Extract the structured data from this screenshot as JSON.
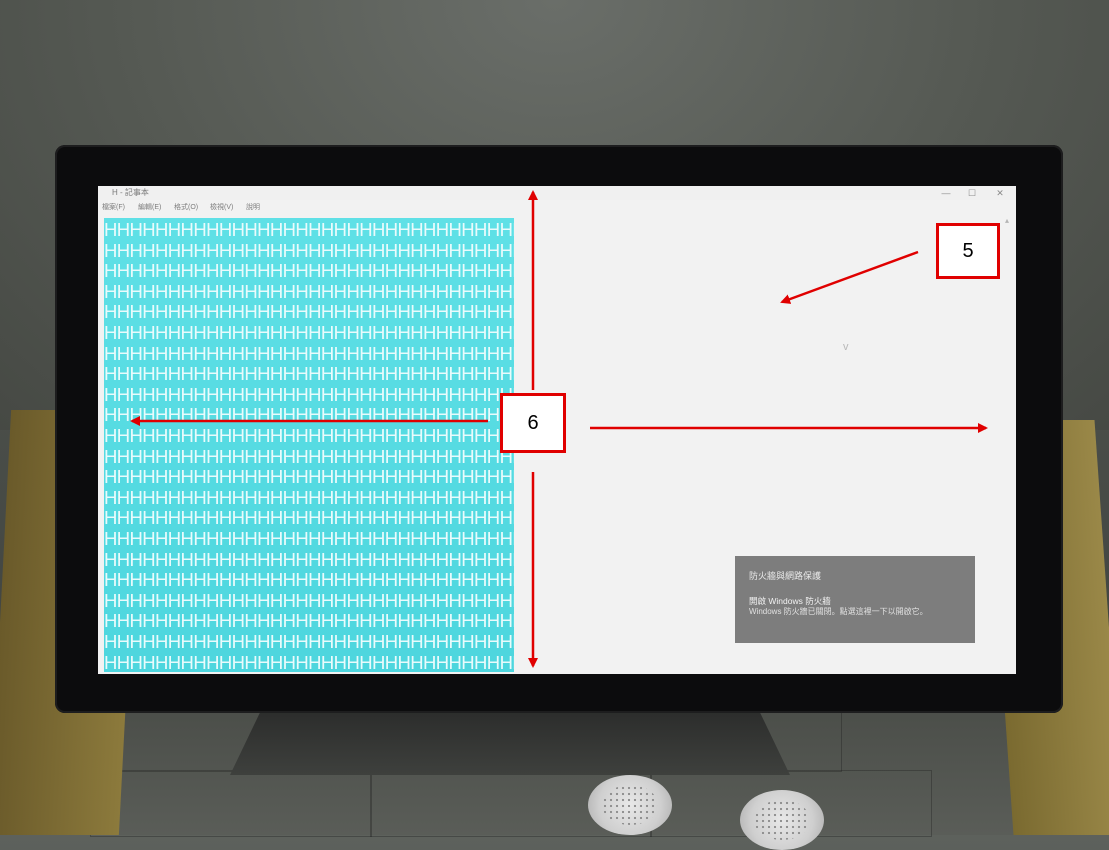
{
  "notepad": {
    "title": "H - 記事本",
    "menu": [
      "檔案(F)",
      "編輯(E)",
      "格式(O)",
      "檢視(V)",
      "說明"
    ],
    "window_buttons": {
      "minimize": "—",
      "maximize": "☐",
      "close": "✕"
    },
    "line_text": "HHHHHHHHHHHHHHHHHHHHHHHHHHHHHHHHHHHHHHHHH",
    "line_count": 22
  },
  "desktop": {
    "cursor_glyph": "v"
  },
  "toast": {
    "title": "防火牆與網路保護",
    "heading": "開啟 Windows 防火牆",
    "body": "Windows 防火牆已關閉。點選這裡一下以開啟它。"
  },
  "annotations": {
    "label_5": "5",
    "label_6": "6",
    "arrow_color": "#e00000"
  }
}
